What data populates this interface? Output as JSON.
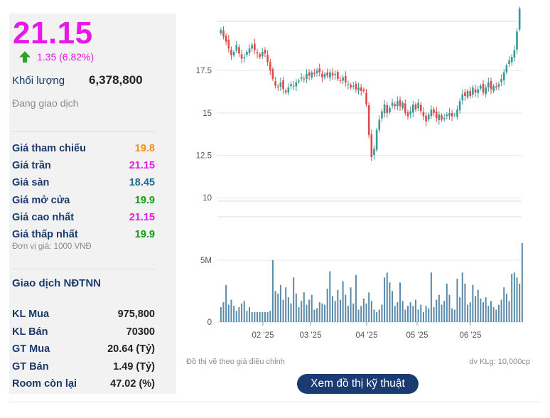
{
  "quote": {
    "price": "21.15",
    "change": "1.35 (6.82%)",
    "volume_label": "Khối lượng",
    "volume": "6,378,800",
    "status": "Đang giao dịch",
    "direction_icon": "up-arrow-icon",
    "color_up": "#e619e6"
  },
  "prices": [
    {
      "label": "Giá tham chiếu",
      "value": "19.8",
      "color": "#f0901c"
    },
    {
      "label": "Giá trần",
      "value": "21.15",
      "color": "#e619e6"
    },
    {
      "label": "Giá sàn",
      "value": "18.45",
      "color": "#1a6e96"
    },
    {
      "label": "Giá mở cửa",
      "value": "19.9",
      "color": "#179817"
    },
    {
      "label": "Giá cao nhất",
      "value": "21.15",
      "color": "#e619e6"
    },
    {
      "label": "Giá thấp nhất",
      "value": "19.9",
      "color": "#179817"
    }
  ],
  "unit_note": "Đơn vị giá: 1000 VNĐ",
  "foreign": {
    "title": "Giao dịch NĐTNN",
    "rows": [
      {
        "label": "KL Mua",
        "value": "975,800"
      },
      {
        "label": "KL Bán",
        "value": "70300"
      },
      {
        "label": "GT Mua",
        "value": "20.64 (Tỷ)"
      },
      {
        "label": "GT Bán",
        "value": "1.49 (Tỷ)"
      },
      {
        "label": "Room còn lại",
        "value": "47.02 (%)"
      }
    ]
  },
  "chart_notes": {
    "left": "Đồ thị vẽ theo giá điều chỉnh",
    "right": "dv KLg: 10,000cp"
  },
  "tech_button": "Xem đồ thị kỹ thuật",
  "chart_data": {
    "type": "candlestick",
    "x_tick_labels": [
      "02 '25",
      "03 '25",
      "04 '25",
      "05 '25",
      "06 '25"
    ],
    "price_axis": {
      "ticks": [
        "10",
        "12.5",
        "15",
        "17.5"
      ],
      "ylim": [
        9.8,
        20.4
      ]
    },
    "volume_axis": {
      "ticks": [
        "0",
        "5M"
      ],
      "ylim": [
        0,
        8.5
      ]
    },
    "up_color": "#3a9a9a",
    "down_color": "#e04a4a",
    "volume_color": "#5a8aaa",
    "close": [
      19.9,
      19.5,
      19.2,
      18.8,
      18.4,
      18.6,
      19.0,
      18.5,
      18.2,
      18.3,
      18.6,
      18.8,
      19.0,
      18.7,
      18.5,
      18.3,
      18.6,
      18.5,
      18.0,
      17.5,
      17.0,
      16.6,
      16.5,
      16.8,
      16.4,
      16.2,
      16.5,
      16.7,
      16.6,
      16.8,
      16.9,
      17.1,
      17.0,
      17.3,
      17.2,
      17.4,
      17.3,
      17.5,
      17.4,
      17.1,
      17.3,
      17.2,
      17.4,
      17.2,
      17.3,
      17.0,
      16.9,
      17.1,
      16.8,
      16.7,
      16.5,
      16.6,
      16.4,
      16.5,
      16.3,
      16.3,
      15.5,
      13.7,
      12.4,
      12.9,
      14.0,
      14.6,
      15.1,
      15.5,
      15.0,
      15.3,
      15.6,
      15.4,
      15.7,
      15.4,
      15.6,
      15.0,
      14.8,
      15.1,
      15.5,
      15.2,
      15.6,
      15.1,
      14.8,
      14.5,
      14.9,
      15.2,
      15.0,
      14.7,
      14.9,
      14.6,
      14.7,
      14.9,
      15.0,
      14.8,
      14.9,
      15.2,
      15.7,
      16.1,
      16.0,
      16.3,
      16.0,
      16.5,
      16.2,
      16.4,
      16.6,
      16.2,
      16.5,
      16.8,
      16.4,
      16.6,
      16.5,
      16.7,
      17.0,
      17.4,
      17.8,
      18.1,
      18.3,
      18.7,
      19.8,
      21.15
    ],
    "volume": [
      1.2,
      1.6,
      3.0,
      1.4,
      1.8,
      1.3,
      0.9,
      1.2,
      1.5,
      1.7,
      0.9,
      1.2,
      0.8,
      0.8,
      0.8,
      0.8,
      0.8,
      0.8,
      0.8,
      0.9,
      5.0,
      2.5,
      2.3,
      3.0,
      1.8,
      2.8,
      2.0,
      1.5,
      3.6,
      2.3,
      1.2,
      1.7,
      2.4,
      1.4,
      1.8,
      2.2,
      1.0,
      1.1,
      1.6,
      1.5,
      1.4,
      2.7,
      4.1,
      2.1,
      1.7,
      2.6,
      1.8,
      3.3,
      2.2,
      1.3,
      2.8,
      1.5,
      3.8,
      1.0,
      1.3,
      1.9,
      1.5,
      2.4,
      1.7,
      1.0,
      0.8,
      1.0,
      1.4,
      3.6,
      4.0,
      3.2,
      2.5,
      1.3,
      1.6,
      3.2,
      1.7,
      1.0,
      1.3,
      1.6,
      1.3,
      1.8,
      1.0,
      1.4,
      0.8,
      1.3,
      1.1,
      4.0,
      1.2,
      1.8,
      2.2,
      1.4,
      1.7,
      3.1,
      2.2,
      1.1,
      1.0,
      3.5,
      2.0,
      4.0,
      3.1,
      1.4,
      1.6,
      3.0,
      2.1,
      2.6,
      1.9,
      1.6,
      2.0,
      1.3,
      1.7,
      1.2,
      1.0,
      1.4,
      1.8,
      2.8,
      2.3,
      1.7,
      3.9,
      4.0,
      3.6,
      3.1,
      6.38
    ]
  }
}
